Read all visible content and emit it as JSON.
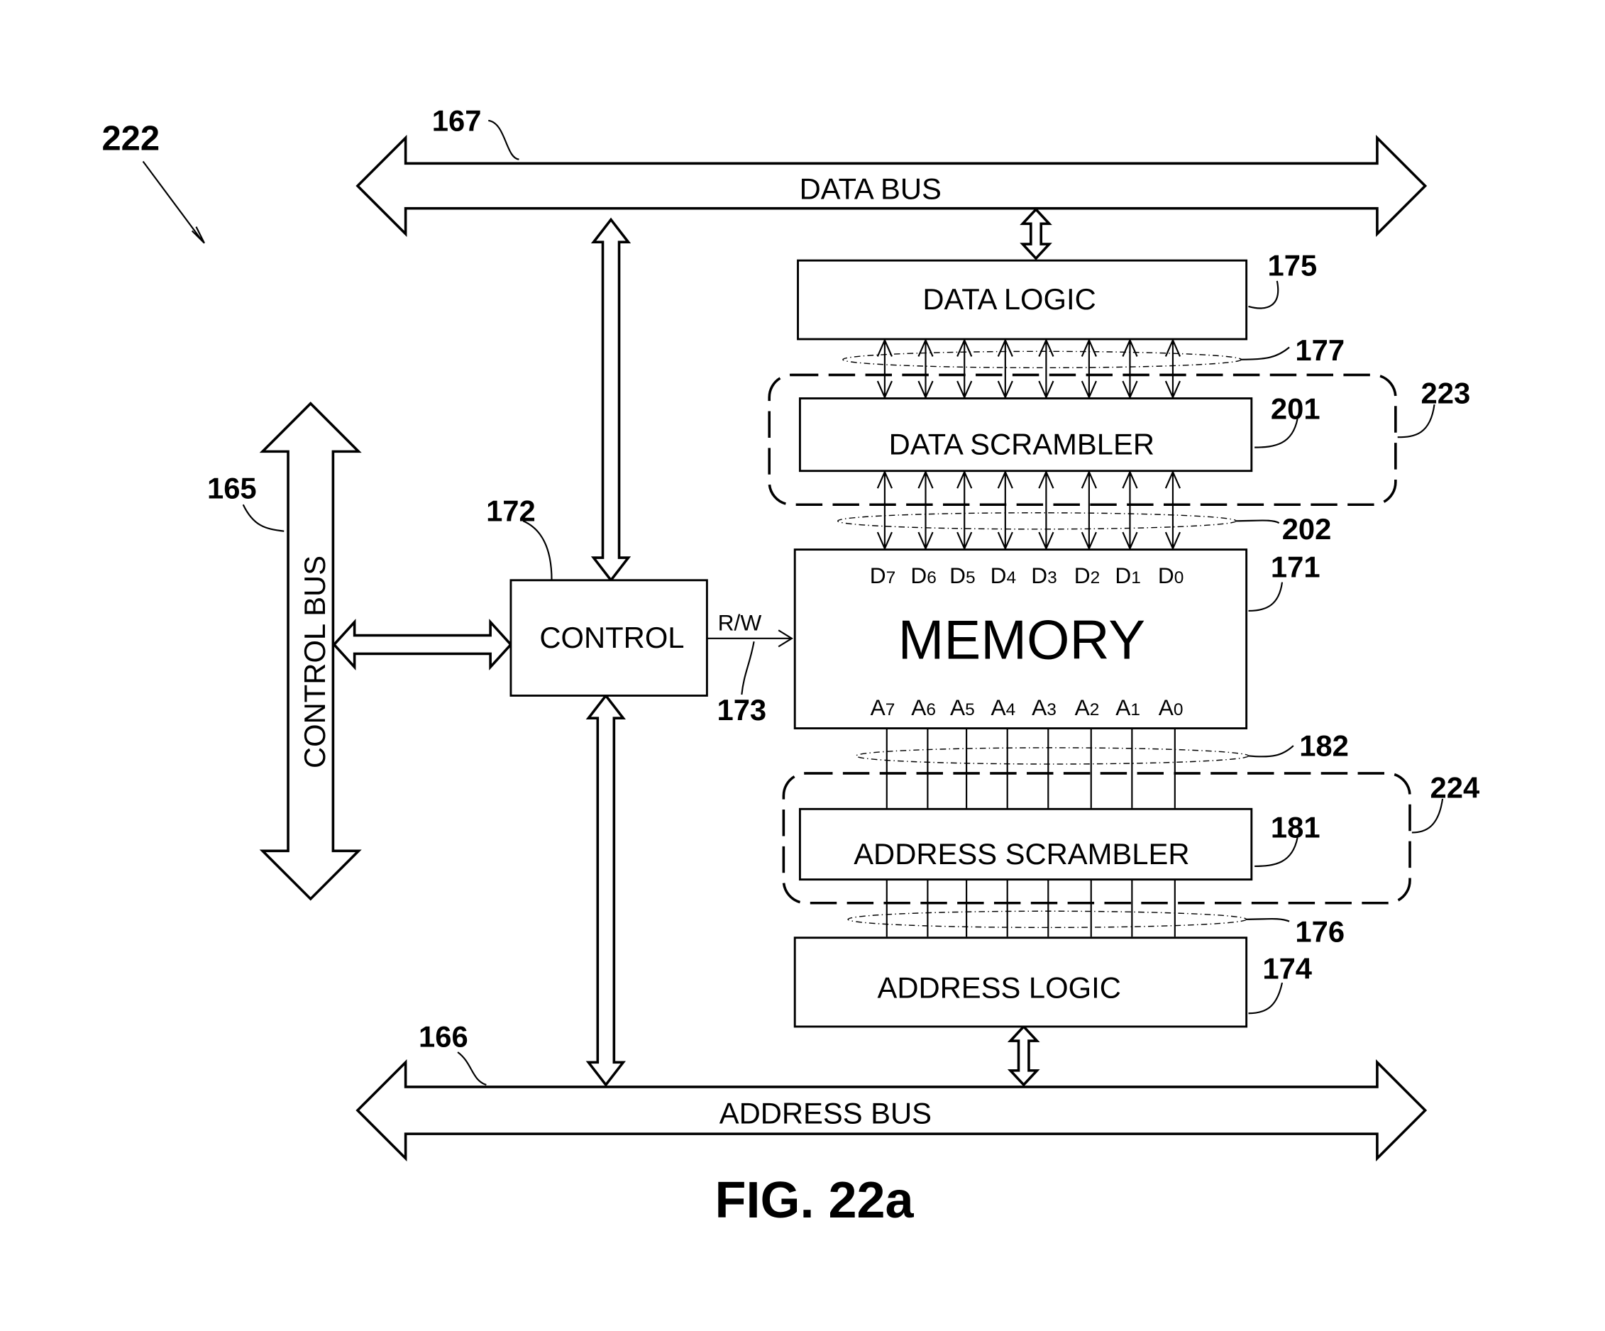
{
  "figure": {
    "number_label": "222",
    "caption": "FIG. 22a"
  },
  "buses": {
    "data": {
      "label": "DATA BUS",
      "ref": "167"
    },
    "address": {
      "label": "ADDRESS BUS",
      "ref": "166"
    },
    "control": {
      "label": "CONTROL BUS",
      "ref": "165"
    }
  },
  "blocks": {
    "control": {
      "label": "CONTROL",
      "ref": "172"
    },
    "data_logic": {
      "label": "DATA LOGIC",
      "ref": "175"
    },
    "data_scrambler": {
      "label": "DATA SCRAMBLER",
      "ref": "201"
    },
    "memory": {
      "label": "MEMORY",
      "ref": "171"
    },
    "address_scrambler": {
      "label": "ADDRESS SCRAMBLER",
      "ref": "181"
    },
    "address_logic": {
      "label": "ADDRESS LOGIC",
      "ref": "174"
    }
  },
  "groups": {
    "data_group_ref": "223",
    "address_group_ref": "224"
  },
  "signals": {
    "rw": {
      "label": "R/W",
      "ref": "173"
    }
  },
  "line_bundles": {
    "data_logic_scrambler": "177",
    "scrambler_memory": "202",
    "memory_address_scrambler": "182",
    "address_scrambler_logic": "176"
  },
  "memory_pins": {
    "data": [
      {
        "l": "D",
        "s": "7"
      },
      {
        "l": "D",
        "s": "6"
      },
      {
        "l": "D",
        "s": "5"
      },
      {
        "l": "D",
        "s": "4"
      },
      {
        "l": "D",
        "s": "3"
      },
      {
        "l": "D",
        "s": "2"
      },
      {
        "l": "D",
        "s": "1"
      },
      {
        "l": "D",
        "s": "0"
      }
    ],
    "address": [
      {
        "l": "A",
        "s": "7"
      },
      {
        "l": "A",
        "s": "6"
      },
      {
        "l": "A",
        "s": "5"
      },
      {
        "l": "A",
        "s": "4"
      },
      {
        "l": "A",
        "s": "3"
      },
      {
        "l": "A",
        "s": "2"
      },
      {
        "l": "A",
        "s": "1"
      },
      {
        "l": "A",
        "s": "0"
      }
    ]
  }
}
